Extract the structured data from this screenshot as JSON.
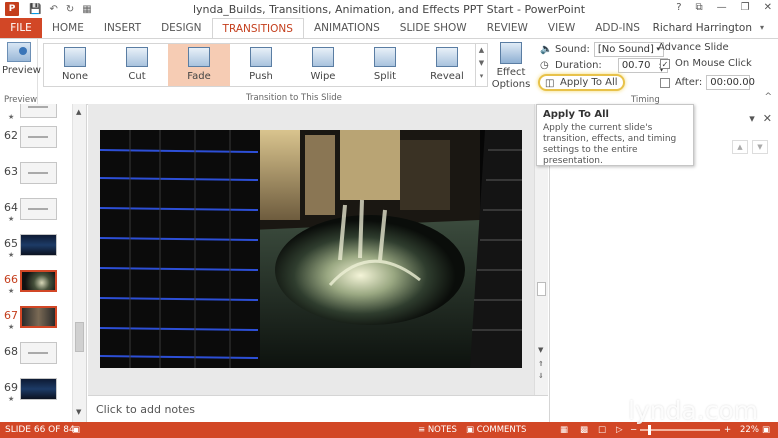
{
  "window": {
    "title": "lynda_Builds, Transitions, Animation, and Effects PPT Start - PowerPoint",
    "app_badge": "P",
    "qat": [
      "save-icon",
      "undo-icon",
      "redo-icon",
      "start-presentation-icon"
    ],
    "controls": [
      "?",
      "⧉",
      "—",
      "❐",
      "✕"
    ]
  },
  "tabs": [
    "FILE",
    "HOME",
    "INSERT",
    "DESIGN",
    "TRANSITIONS",
    "ANIMATIONS",
    "SLIDE SHOW",
    "REVIEW",
    "VIEW",
    "ADD-INS"
  ],
  "active_tab": "TRANSITIONS",
  "user": "Richard Harrington",
  "ribbon": {
    "preview_label": "Preview",
    "preview_group": "Preview",
    "transitions": [
      "None",
      "Cut",
      "Fade",
      "Push",
      "Wipe",
      "Split",
      "Reveal"
    ],
    "selected_transition": "Fade",
    "effect_options": "Effect Options",
    "transition_group": "Transition to This Slide",
    "timing_group": "Timing",
    "sound_label": "Sound:",
    "sound_value": "[No Sound]",
    "duration_label": "Duration:",
    "duration_value": "00.70",
    "apply_all": "Apply To All",
    "advance_label": "Advance Slide",
    "on_mouse_click": "On Mouse Click",
    "on_mouse_click_checked": true,
    "after_label": "After:",
    "after_value": "00:00.00",
    "after_checked": false
  },
  "tooltip": {
    "title": "Apply To All",
    "body": "Apply the current slide's transition, effects, and timing settings to the entire presentation."
  },
  "thumbnails": [
    {
      "num": "62",
      "kind": "text",
      "selected": false,
      "star": false
    },
    {
      "num": "63",
      "kind": "text",
      "selected": false,
      "star": false
    },
    {
      "num": "64",
      "kind": "text",
      "selected": false,
      "star": true
    },
    {
      "num": "65",
      "kind": "city",
      "selected": false,
      "star": true
    },
    {
      "num": "66",
      "kind": "night",
      "selected": true,
      "star": true
    },
    {
      "num": "67",
      "kind": "build",
      "selected": true,
      "star": true
    },
    {
      "num": "68",
      "kind": "text",
      "selected": false,
      "star": false
    },
    {
      "num": "69",
      "kind": "city",
      "selected": false,
      "star": true
    }
  ],
  "notes_placeholder": "Click to add notes",
  "status": {
    "slide_counter": "SLIDE 66 OF 84",
    "notes": "NOTES",
    "comments": "COMMENTS",
    "zoom": "22%"
  },
  "watermark": "lynda.com",
  "colors": {
    "accent": "#d24726",
    "selected_transition_bg": "#f6ccb4",
    "highlight_ring": "#e8c24a"
  }
}
